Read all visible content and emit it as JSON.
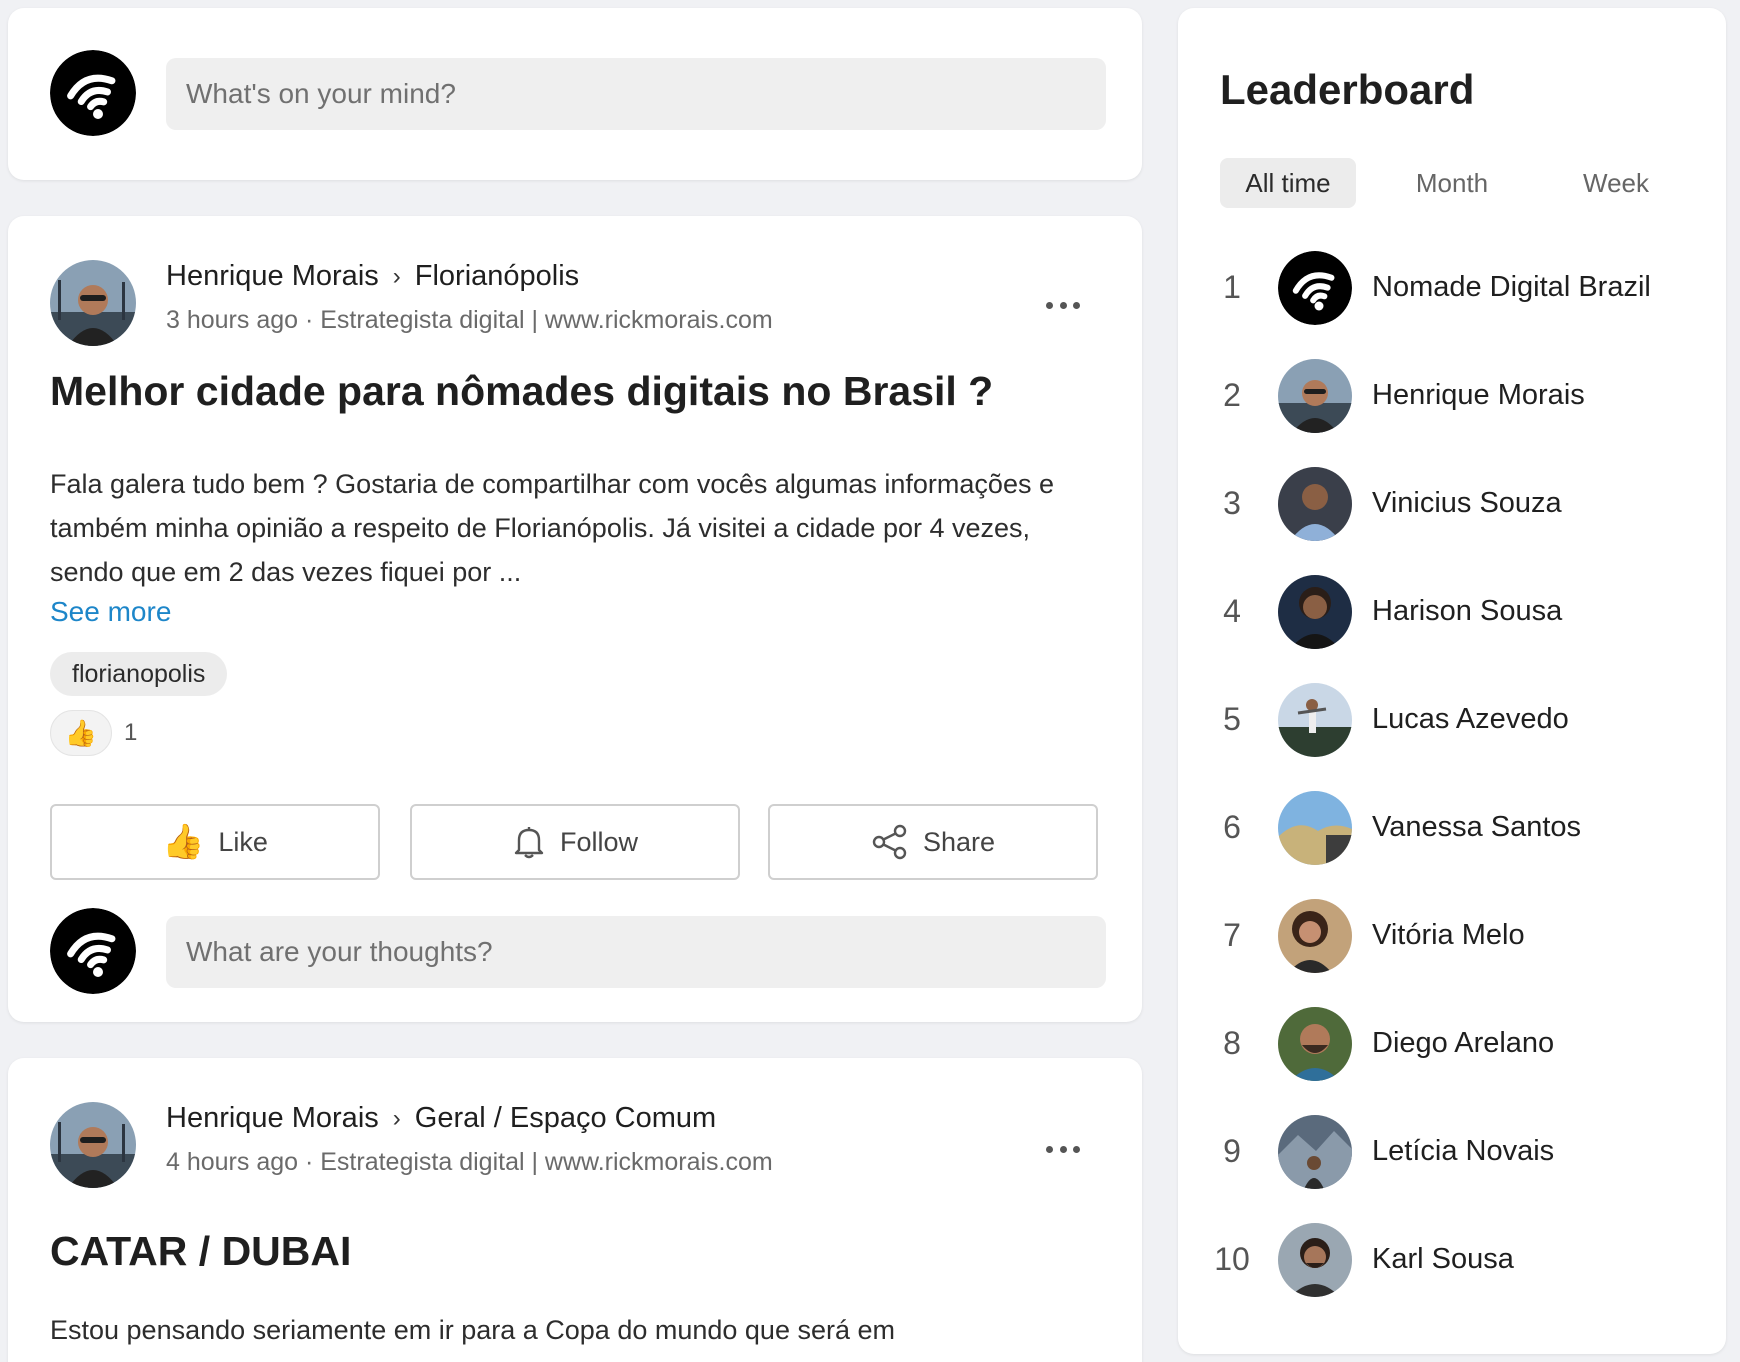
{
  "composer": {
    "placeholder": "What's on your mind?"
  },
  "post1": {
    "author": "Henrique Morais",
    "space": "Florianópolis",
    "meta": "3 hours ago · Estrategista digital | www.rickmorais.com",
    "title": "Melhor cidade para nômades digitais no Brasil ?",
    "body": "Fala galera tudo bem ? Gostaria de compartilhar com vocês algumas informações e também minha opinião a respeito de Florianópolis. Já visitei a cidade por 4 vezes, sendo que em 2 das vezes fiquei por ...",
    "see_more": "See more",
    "tag": "florianopolis",
    "reaction_emoji": "👍",
    "reaction_count": "1",
    "actions": {
      "like": "Like",
      "follow": "Follow",
      "share": "Share"
    },
    "comment_placeholder": "What are your thoughts?"
  },
  "post2": {
    "author": "Henrique Morais",
    "space": "Geral / Espaço Comum",
    "meta": "4 hours ago · Estrategista digital | www.rickmorais.com",
    "title": "CATAR / DUBAI",
    "body": "Estou pensando seriamente em ir para a Copa do mundo que será em"
  },
  "leaderboard": {
    "title": "Leaderboard",
    "tabs": [
      "All time",
      "Month",
      "Week"
    ],
    "active_tab": "All time",
    "entries": [
      {
        "rank": "1",
        "name": "Nomade Digital Brazil"
      },
      {
        "rank": "2",
        "name": "Henrique Morais"
      },
      {
        "rank": "3",
        "name": "Vinicius Souza"
      },
      {
        "rank": "4",
        "name": "Harison Sousa"
      },
      {
        "rank": "5",
        "name": "Lucas Azevedo"
      },
      {
        "rank": "6",
        "name": "Vanessa Santos"
      },
      {
        "rank": "7",
        "name": "Vitória Melo"
      },
      {
        "rank": "8",
        "name": "Diego Arelano"
      },
      {
        "rank": "9",
        "name": "Letícia Novais"
      },
      {
        "rank": "10",
        "name": "Karl Sousa"
      }
    ]
  },
  "colors": {
    "page_bg": "#f0f1f4",
    "card_bg": "#ffffff",
    "link": "#1d86c9",
    "input_bg": "#efefef",
    "brand_avatar": "#000000"
  }
}
